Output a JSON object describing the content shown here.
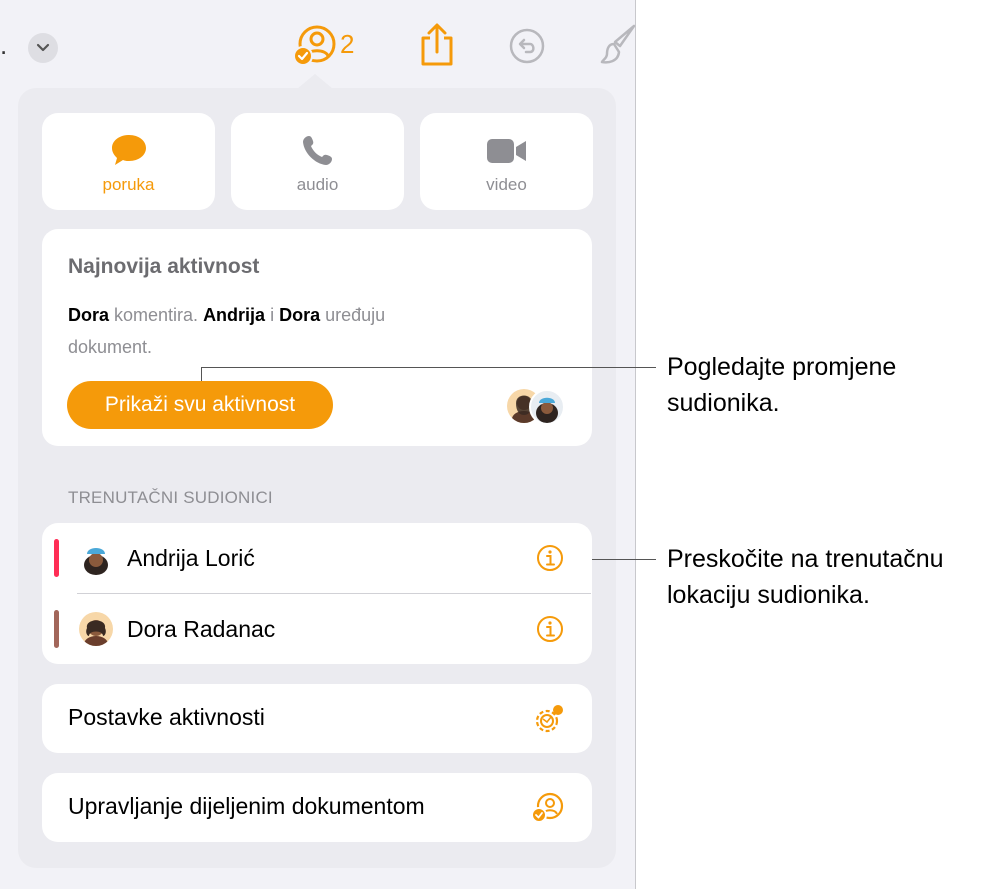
{
  "toolbar": {
    "overflow_text": ".",
    "collab_count": "2",
    "icons": [
      "chevron-down-icon",
      "collaboration-icon",
      "share-icon",
      "undo-icon",
      "format-brush-icon"
    ]
  },
  "communication": [
    {
      "label": "poruka",
      "icon": "message-bubble-icon",
      "color": "#f59a0a"
    },
    {
      "label": "audio",
      "icon": "phone-icon",
      "color": "#8e8e93"
    },
    {
      "label": "video",
      "icon": "video-camera-icon",
      "color": "#8e8e93"
    }
  ],
  "activity": {
    "title": "Najnovija aktivnost",
    "name1": "Dora",
    "text1": " komentira. ",
    "name2": "Andrija",
    "text2": " i ",
    "name3": "Dora",
    "text3": " uređuju dokument.",
    "button_label": "Prikaži svu aktivnost"
  },
  "participants": {
    "header": "TRENUTAČNI SUDIONICI",
    "items": [
      {
        "name": "Andrija Lorić",
        "bar_color": "#ff2d55"
      },
      {
        "name": "Dora Radanac",
        "bar_color": "#a2665a"
      }
    ]
  },
  "settings": {
    "activity_settings_label": "Postavke aktivnosti",
    "manage_label": "Upravljanje dijeljenim dokumentom"
  },
  "callouts": {
    "first": [
      "Pogledajte promjene",
      "sudionika."
    ],
    "second": [
      "Preskočite na trenutačnu",
      "lokaciju sudionika."
    ]
  },
  "colors": {
    "accent": "#f59a0a",
    "secondary_text": "#8e8e93"
  }
}
